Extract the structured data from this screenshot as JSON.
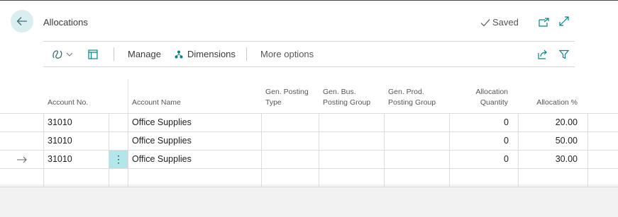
{
  "header": {
    "title": "Allocations",
    "saved_label": "Saved"
  },
  "actionbar": {
    "manage_label": "Manage",
    "dimensions_label": "Dimensions",
    "more_options_label": "More options"
  },
  "table": {
    "columns": {
      "account_no": "Account No.",
      "account_name": "Account Name",
      "gen_posting_type_l1": "Gen. Posting",
      "gen_posting_type_l2": "Type",
      "gen_bus_l1": "Gen. Bus.",
      "gen_bus_l2": "Posting Group",
      "gen_prod_l1": "Gen. Prod.",
      "gen_prod_l2": "Posting Group",
      "alloc_qty_l1": "Allocation",
      "alloc_qty_l2": "Quantity",
      "alloc_pct": "Allocation %"
    },
    "rows": [
      {
        "account_no": "31010",
        "account_name": "Office Supplies",
        "gen_posting_type": "",
        "gen_bus": "",
        "gen_prod": "",
        "alloc_qty": "0",
        "alloc_pct": "20.00"
      },
      {
        "account_no": "31010",
        "account_name": "Office Supplies",
        "gen_posting_type": "",
        "gen_bus": "",
        "gen_prod": "",
        "alloc_qty": "0",
        "alloc_pct": "50.00"
      },
      {
        "account_no": "31010",
        "account_name": "Office Supplies",
        "gen_posting_type": "",
        "gen_bus": "",
        "gen_prod": "",
        "alloc_qty": "0",
        "alloc_pct": "30.00"
      }
    ]
  },
  "colors": {
    "accent": "#008489",
    "back_button_bg": "#d9eef0",
    "selected_cell_bg": "#b3e6ea"
  }
}
